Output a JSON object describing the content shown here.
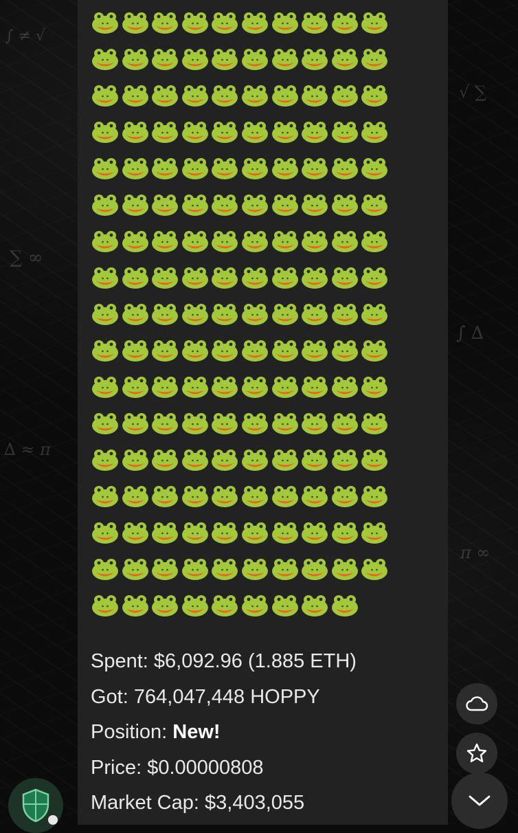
{
  "message": {
    "frog_rows": [
      10,
      10,
      10,
      10,
      10,
      10,
      10,
      10,
      10,
      10,
      10,
      10,
      10,
      10,
      10,
      10,
      9
    ],
    "lines": {
      "spent_label": "Spent:",
      "spent_value": "$6,092.96 (1.885 ETH)",
      "got_label": "Got:",
      "got_value": "764,047,448 HOPPY",
      "position_label": "Position:",
      "position_value": "New!",
      "price_label": "Price:",
      "price_value": "$0.00000808",
      "mcap_label": "Market Cap:",
      "mcap_value": "$3,403,055"
    }
  },
  "side_actions": {
    "cloud_icon": "cloud-icon",
    "star_icon": "star-icon",
    "scroll_icon": "chevron-down-icon"
  },
  "avatar": {
    "icon": "shield-icon"
  },
  "colors": {
    "bubble": "#222222",
    "frog_body": "#a3c93a",
    "frog_mouth": "#e9641e",
    "text": "#e9e9e9"
  }
}
